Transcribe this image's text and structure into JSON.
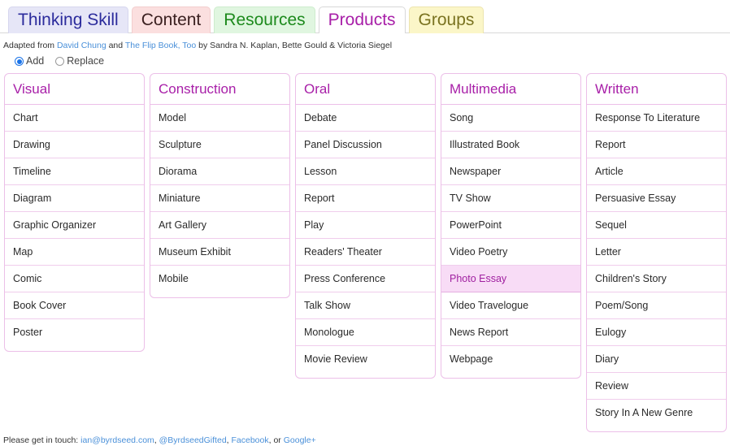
{
  "tabs": [
    {
      "label": "Thinking Skill",
      "active": false
    },
    {
      "label": "Content",
      "active": false
    },
    {
      "label": "Resources",
      "active": false
    },
    {
      "label": "Products",
      "active": true
    },
    {
      "label": "Groups",
      "active": false
    }
  ],
  "credits": {
    "prefix": "Adapted from ",
    "link1": "David Chung",
    "middle": " and ",
    "link2": "The Flip Book, Too",
    "suffix": " by Sandra N. Kaplan, Bette Gould & Victoria Siegel"
  },
  "modes": {
    "add_label": "Add",
    "replace_label": "Replace",
    "selected": "Add"
  },
  "columns": [
    {
      "title": "Visual",
      "items": [
        "Chart",
        "Drawing",
        "Timeline",
        "Diagram",
        "Graphic Organizer",
        "Map",
        "Comic",
        "Book Cover",
        "Poster"
      ],
      "selected_index": -1
    },
    {
      "title": "Construction",
      "items": [
        "Model",
        "Sculpture",
        "Diorama",
        "Miniature",
        "Art Gallery",
        "Museum Exhibit",
        "Mobile"
      ],
      "selected_index": -1
    },
    {
      "title": "Oral",
      "items": [
        "Debate",
        "Panel Discussion",
        "Lesson",
        "Report",
        "Play",
        "Readers' Theater",
        "Press Conference",
        "Talk Show",
        "Monologue",
        "Movie Review"
      ],
      "selected_index": -1
    },
    {
      "title": "Multimedia",
      "items": [
        "Song",
        "Illustrated Book",
        "Newspaper",
        "TV Show",
        "PowerPoint",
        "Video Poetry",
        "Photo Essay",
        "Video Travelogue",
        "News Report",
        "Webpage"
      ],
      "selected_index": 6
    },
    {
      "title": "Written",
      "items": [
        "Response To Literature",
        "Report",
        "Article",
        "Persuasive Essay",
        "Sequel",
        "Letter",
        "Children's Story",
        "Poem/Song",
        "Eulogy",
        "Diary",
        "Review",
        "Story In A New Genre"
      ],
      "selected_index": -1
    }
  ],
  "footer": {
    "prefix": "Please get in touch: ",
    "email": "ian@byrdseed.com",
    "sep1": ", ",
    "twitter": "@ByrdseedGifted",
    "sep2": ", ",
    "facebook": "Facebook",
    "sep3": ", or ",
    "google": "Google+"
  },
  "colors": {
    "accent": "#a81fa8",
    "border": "#ecbfe8",
    "selected_bg": "#f8dcf6",
    "link": "#4a90d9"
  }
}
